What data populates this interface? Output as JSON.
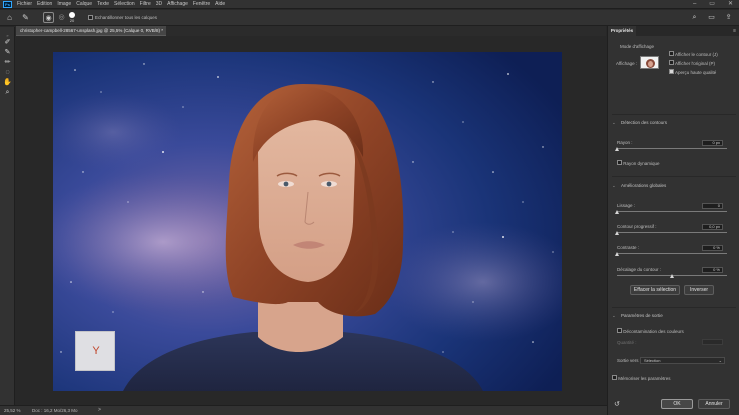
{
  "app": {
    "logo": "Ps"
  },
  "menubar": {
    "items": [
      "Fichier",
      "Edition",
      "Image",
      "Calque",
      "Texte",
      "Sélection",
      "Filtre",
      "3D",
      "Affichage",
      "Fenêtre",
      "Aide"
    ],
    "window_controls": [
      "–",
      "▭",
      "✕"
    ]
  },
  "options_bar": {
    "brush_size": "20",
    "sample_all_layers": "Echantillonner tous les calques",
    "sample_all_checked": false
  },
  "document": {
    "tab_title": "christopher-campbell-28567-unsplash.jpg @ 25,5% (Calque 0, RVB/8) *",
    "watermark_letter": "Y"
  },
  "status": {
    "zoom": "25,52 %",
    "doc_size": "Doc : 16,2 Mo/26,3 Mo",
    "arrow": ">"
  },
  "properties": {
    "tab": "Propriétés",
    "menu_icon": "≡",
    "view_mode": {
      "title": "Mode d'affichage",
      "affichage_label": "Affichage :",
      "show_edge": "Afficher le contour (J)",
      "show_original": "Afficher l'original (P)",
      "high_quality": "Aperçu haute qualité",
      "show_edge_checked": false,
      "show_original_checked": false,
      "high_quality_checked": true
    },
    "edge_detection": {
      "title": "Détection des contours",
      "radius_label": "Rayon :",
      "radius_value": "0 px",
      "smart_radius": "Rayon dynamique",
      "smart_radius_checked": false,
      "radius_fraction": 0.0
    },
    "global_refinements": {
      "title": "Améliorations globales",
      "smooth_label": "Lissage :",
      "smooth_value": "0",
      "smooth_fraction": 0.0,
      "feather_label": "Contour progressif :",
      "feather_value": "0,0 px",
      "feather_fraction": 0.0,
      "contrast_label": "Contraste :",
      "contrast_value": "0 %",
      "contrast_fraction": 0.0,
      "shift_edge_label": "Décalage du contour :",
      "shift_edge_value": "0 %",
      "shift_edge_fraction": 0.5,
      "clear_selection": "Effacer la sélection",
      "invert": "Inverser"
    },
    "output": {
      "title": "Paramètres de sortie",
      "decontaminate": "Décontamination des couleurs",
      "decontaminate_checked": false,
      "quantity_label": "Quantité :",
      "output_to_label": "Sortie vers :",
      "output_to_value": "Sélection"
    },
    "remember": "Mémoriser les paramètres",
    "remember_checked": false,
    "ok": "OK",
    "cancel": "Annuler"
  }
}
